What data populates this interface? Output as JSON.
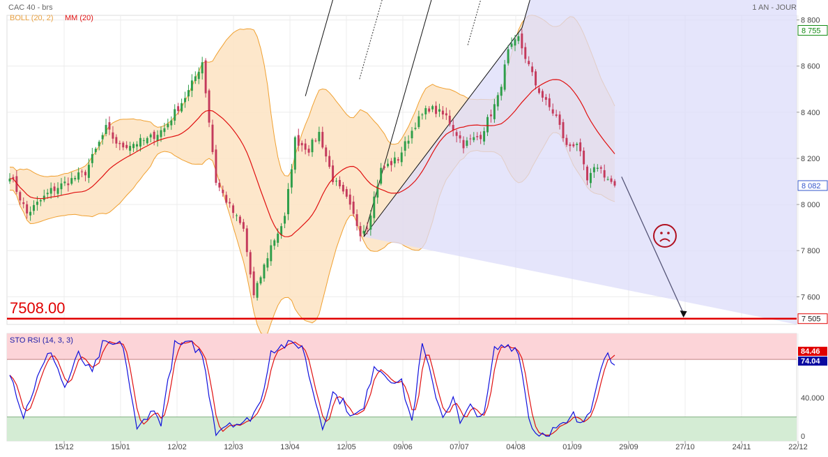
{
  "header": {
    "instrument": "CAC 40 - brs",
    "period": "1 AN - JOUR",
    "boll_label": "BOLL (20, 2)",
    "mm_label": "MM (20)"
  },
  "annotations": {
    "support_label": "7508.00"
  },
  "oscillator": {
    "label": "STO RSI (14, 3, 3)"
  },
  "colors": {
    "bull": "#2e9e4a",
    "bear": "#c43a5c",
    "mm": "#e01010",
    "boll_fill": "#fde3c2",
    "boll_line": "#f0a030",
    "channel_fill": "#dcdcfa",
    "support": "#e00000",
    "sto_k": "#1010dd",
    "sto_d": "#e01010",
    "zone_high": "#fcd4d8",
    "zone_low": "#d4ecd4",
    "tag_green": "#138a13",
    "tag_blue": "#3355cc",
    "tag_red": "#e00000",
    "tag_dark_blue": "#0a0aa0"
  },
  "chart_data": [
    {
      "type": "candlestick",
      "name": "CAC 40",
      "ylim": [
        7480,
        8820
      ],
      "yticks": [
        {
          "v": 8800,
          "label": "8 800"
        },
        {
          "v": 8600,
          "label": "8 600"
        },
        {
          "v": 8400,
          "label": "8 400"
        },
        {
          "v": 8200,
          "label": "8 200"
        },
        {
          "v": 8000,
          "label": "8 000"
        },
        {
          "v": 7800,
          "label": "7 800"
        },
        {
          "v": 7600,
          "label": "7 600"
        }
      ],
      "xticks": [
        "15/12",
        "15/01",
        "12/02",
        "12/03",
        "13/04",
        "12/05",
        "09/06",
        "07/07",
        "04/08",
        "01/09",
        "29/09",
        "27/10",
        "24/11",
        "22/12"
      ],
      "price_tags": [
        {
          "v": 8755,
          "label": "8 755",
          "style": "green"
        },
        {
          "v": 8082,
          "label": "8 082",
          "style": "blue"
        },
        {
          "v": 7505,
          "label": "7 505",
          "style": "red"
        }
      ],
      "support_level": 7505,
      "anchors": [
        {
          "i": 0,
          "v": 8130
        },
        {
          "i": 5,
          "v": 7960
        },
        {
          "i": 12,
          "v": 8060
        },
        {
          "i": 22,
          "v": 8140
        },
        {
          "i": 28,
          "v": 8330
        },
        {
          "i": 32,
          "v": 8250
        },
        {
          "i": 40,
          "v": 8280
        },
        {
          "i": 45,
          "v": 8330
        },
        {
          "i": 52,
          "v": 8490
        },
        {
          "i": 56,
          "v": 8620
        },
        {
          "i": 60,
          "v": 8100
        },
        {
          "i": 64,
          "v": 7990
        },
        {
          "i": 68,
          "v": 7890
        },
        {
          "i": 71,
          "v": 7600
        },
        {
          "i": 76,
          "v": 7820
        },
        {
          "i": 80,
          "v": 7940
        },
        {
          "i": 83,
          "v": 8280
        },
        {
          "i": 87,
          "v": 8240
        },
        {
          "i": 90,
          "v": 8310
        },
        {
          "i": 94,
          "v": 8110
        },
        {
          "i": 98,
          "v": 8020
        },
        {
          "i": 102,
          "v": 7880
        },
        {
          "i": 104,
          "v": 7910
        },
        {
          "i": 108,
          "v": 8150
        },
        {
          "i": 113,
          "v": 8200
        },
        {
          "i": 118,
          "v": 8350
        },
        {
          "i": 122,
          "v": 8420
        },
        {
          "i": 127,
          "v": 8380
        },
        {
          "i": 132,
          "v": 8260
        },
        {
          "i": 137,
          "v": 8300
        },
        {
          "i": 142,
          "v": 8460
        },
        {
          "i": 145,
          "v": 8660
        },
        {
          "i": 148,
          "v": 8720
        },
        {
          "i": 150,
          "v": 8640
        },
        {
          "i": 153,
          "v": 8520
        },
        {
          "i": 156,
          "v": 8440
        },
        {
          "i": 159,
          "v": 8380
        },
        {
          "i": 162,
          "v": 8250
        },
        {
          "i": 165,
          "v": 8270
        },
        {
          "i": 168,
          "v": 8100
        },
        {
          "i": 171,
          "v": 8170
        },
        {
          "i": 174,
          "v": 8110
        },
        {
          "i": 176,
          "v": 8082
        }
      ],
      "pitchfork": {
        "start": {
          "i": 103,
          "v": 7860
        },
        "hi": {
          "i": 149,
          "v": 8765
        },
        "lo": {
          "i": 86,
          "v": 8470
        },
        "extend_to": 229
      },
      "forecast_arrow": {
        "from": {
          "i": 178,
          "v": 8120
        },
        "to": {
          "i": 196,
          "v": 7510
        }
      }
    },
    {
      "type": "line",
      "name": "STO RSI (14, 3, 3)",
      "ylim": [
        -5,
        107
      ],
      "yticks": [
        {
          "v": 40,
          "label": "40.000"
        },
        {
          "v": 0,
          "label": "0"
        }
      ],
      "zones": {
        "high": 80,
        "low": 20
      },
      "last": {
        "k": 74.04,
        "d": 84.46,
        "k_label": "74.04",
        "d_label": "84.46"
      },
      "anchors": [
        {
          "i": 0,
          "v": 68
        },
        {
          "i": 4,
          "v": 20
        },
        {
          "i": 8,
          "v": 60
        },
        {
          "i": 12,
          "v": 90
        },
        {
          "i": 16,
          "v": 50
        },
        {
          "i": 20,
          "v": 85
        },
        {
          "i": 24,
          "v": 65
        },
        {
          "i": 27,
          "v": 95
        },
        {
          "i": 33,
          "v": 95
        },
        {
          "i": 37,
          "v": 5
        },
        {
          "i": 41,
          "v": 28
        },
        {
          "i": 44,
          "v": 15
        },
        {
          "i": 48,
          "v": 95
        },
        {
          "i": 53,
          "v": 95
        },
        {
          "i": 56,
          "v": 85
        },
        {
          "i": 60,
          "v": 5
        },
        {
          "i": 64,
          "v": 15
        },
        {
          "i": 68,
          "v": 12
        },
        {
          "i": 70,
          "v": 20
        },
        {
          "i": 73,
          "v": 35
        },
        {
          "i": 76,
          "v": 90
        },
        {
          "i": 80,
          "v": 95
        },
        {
          "i": 85,
          "v": 95
        },
        {
          "i": 88,
          "v": 50
        },
        {
          "i": 91,
          "v": 10
        },
        {
          "i": 94,
          "v": 45
        },
        {
          "i": 97,
          "v": 35
        },
        {
          "i": 100,
          "v": 20
        },
        {
          "i": 103,
          "v": 28
        },
        {
          "i": 106,
          "v": 75
        },
        {
          "i": 110,
          "v": 62
        },
        {
          "i": 114,
          "v": 55
        },
        {
          "i": 117,
          "v": 15
        },
        {
          "i": 120,
          "v": 95
        },
        {
          "i": 123,
          "v": 55
        },
        {
          "i": 126,
          "v": 20
        },
        {
          "i": 129,
          "v": 42
        },
        {
          "i": 131,
          "v": 12
        },
        {
          "i": 134,
          "v": 30
        },
        {
          "i": 138,
          "v": 20
        },
        {
          "i": 141,
          "v": 90
        },
        {
          "i": 145,
          "v": 95
        },
        {
          "i": 148,
          "v": 90
        },
        {
          "i": 151,
          "v": 20
        },
        {
          "i": 153,
          "v": 3
        },
        {
          "i": 156,
          "v": 3
        },
        {
          "i": 159,
          "v": 8
        },
        {
          "i": 162,
          "v": 12
        },
        {
          "i": 164,
          "v": 22
        },
        {
          "i": 166,
          "v": 10
        },
        {
          "i": 169,
          "v": 30
        },
        {
          "i": 172,
          "v": 75
        },
        {
          "i": 174,
          "v": 85
        },
        {
          "i": 176,
          "v": 74
        }
      ]
    }
  ]
}
